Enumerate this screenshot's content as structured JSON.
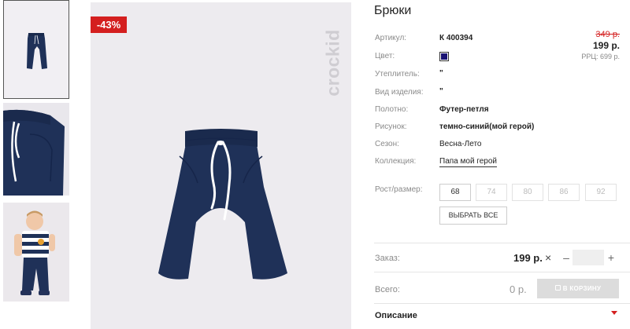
{
  "product": {
    "title": "Брюки",
    "discount": "-43%",
    "brand": "crockid"
  },
  "specs": [
    {
      "label": "Артикул:",
      "value": "К 400394"
    },
    {
      "label": "Цвет:",
      "value": ""
    },
    {
      "label": "Утеплитель:",
      "value": "\""
    },
    {
      "label": "Вид изделия:",
      "value": "\""
    },
    {
      "label": "Полотно:",
      "value": "Футер-петля"
    },
    {
      "label": "Рисунок:",
      "value": "темно-синий(мой герой)"
    },
    {
      "label": "Сезон:",
      "value": "Весна-Лето"
    },
    {
      "label": "Коллекция:",
      "value": "Папа мой герой"
    }
  ],
  "color_swatch": "#1a1373",
  "price": {
    "old": "349 р.",
    "new": "199 р.",
    "rrp": "РРЦ: 699 р."
  },
  "sizes": {
    "label": "Рост/размер:",
    "options": [
      "68",
      "74",
      "80",
      "86",
      "92"
    ],
    "selected": "68",
    "select_all": "ВЫБРАТЬ ВСЕ"
  },
  "order": {
    "label": "Заказ:",
    "price": "199 р.",
    "times": "×",
    "minus": "–",
    "plus": "+",
    "quantity": ""
  },
  "total": {
    "label": "Всего:",
    "value": "0 р.",
    "cart_button": "В КОРЗИНУ"
  },
  "description": {
    "title": "Описание"
  },
  "colors": {
    "accent_red": "#d41f1f",
    "pants_navy": "#1f3158"
  }
}
